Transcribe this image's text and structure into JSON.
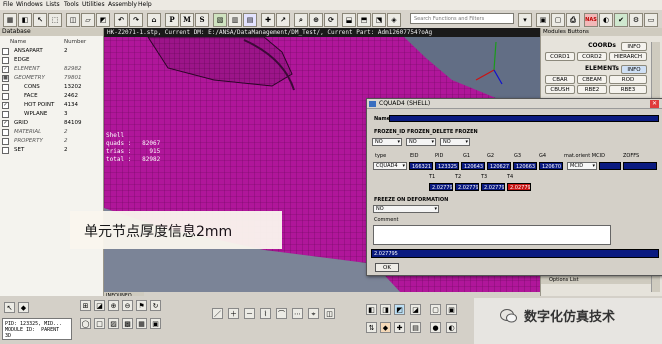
{
  "menu": [
    "File",
    "Windows",
    "Lists",
    "Tools",
    "Utilities",
    "Assembly",
    "Help"
  ],
  "toolbar": {
    "search_placeholder": "Search Functions and Filters",
    "pid_letters": [
      "P",
      "M",
      "S"
    ]
  },
  "database": {
    "title": "Database",
    "col_name": "Name",
    "col_number": "Number",
    "rows": [
      {
        "name": "ANSAPART",
        "count": "2",
        "check": "",
        "indent": 0,
        "italic": false
      },
      {
        "name": "EDGE",
        "count": "",
        "check": "",
        "indent": 0,
        "italic": false
      },
      {
        "name": "ELEMENT",
        "count": "82982",
        "check": "✓",
        "indent": 0,
        "italic": true
      },
      {
        "name": "GEOMETRY",
        "count": "79801",
        "check": "■",
        "indent": 0,
        "italic": true
      },
      {
        "name": "CONS",
        "count": "13202",
        "check": "",
        "indent": 1,
        "italic": false
      },
      {
        "name": "FACE",
        "count": "2462",
        "check": "",
        "indent": 1,
        "italic": false
      },
      {
        "name": "HOT POINT",
        "count": "4134",
        "check": "✓",
        "indent": 1,
        "italic": false
      },
      {
        "name": "WPLANE",
        "count": "3",
        "check": "",
        "indent": 1,
        "italic": false
      },
      {
        "name": "GRID",
        "count": "84109",
        "check": "✓",
        "indent": 0,
        "italic": false
      },
      {
        "name": "MATERIAL",
        "count": "2",
        "check": "",
        "indent": 0,
        "italic": true
      },
      {
        "name": "PROPERTY",
        "count": "2",
        "check": "",
        "indent": 0,
        "italic": true
      },
      {
        "name": "SET",
        "count": "2",
        "check": "",
        "indent": 0,
        "italic": false
      }
    ]
  },
  "viewport": {
    "header": "HK-Z2071-1.stp,  Current DM: E:/ANSA/DataManagement/DM_Test/,  Current Part: Adm12607754?oAg",
    "stats": "Shell\nquads :   82067\ntrias :     915\ntotal :   82982",
    "caption": "单元节点厚度信息2mm",
    "colors": {
      "mesh": "#b0169a",
      "background": "#626e85"
    }
  },
  "info_tab": "INFO|INFO",
  "modules": {
    "title": "Modules Buttons",
    "coords_header": "COORDs",
    "coords_buttons": [
      "INFO",
      "CORD1",
      "CORD2",
      "HIERARCH"
    ],
    "elements_header": "ELEMENTs",
    "elements_buttons": [
      "INFO",
      "CBAR",
      "CBEAM",
      "ROD",
      "CBUSH",
      "RBE2",
      "RBE3"
    ],
    "options_label": "Options List"
  },
  "dialog": {
    "title": "CQUAD4 (SHELL)",
    "name_label": "Name",
    "name_value": "",
    "freeze_label": "FROZEN_ID FROZEN_DELETE FROZEN",
    "freeze_values": [
      "NO",
      "NO",
      "NO"
    ],
    "columns": [
      "type",
      "EID",
      "PID",
      "G1",
      "G2",
      "G3",
      "G4",
      "mat.orient MCID",
      "ZOFFS"
    ],
    "row_values": [
      "CQUAD4",
      "166321",
      "123325",
      "120643",
      "120627",
      "120663",
      "120670",
      "MCID",
      ""
    ],
    "t_labels": [
      "T1",
      "T2",
      "T3",
      "T4"
    ],
    "t_values": [
      "2.027795",
      "2.027795",
      "2.027795",
      "2.027795"
    ],
    "freeze_def_label": "FREEZE ON DEFORMATION",
    "freeze_def_value": "NO",
    "comment_label": "Comment",
    "status_text": "2.027795",
    "ok_label": "OK"
  },
  "status": {
    "text": "PID: 123325, MID...\nMODULE ID:  PARENT\n3D"
  },
  "watermark": {
    "text": "数字化仿真技术"
  }
}
